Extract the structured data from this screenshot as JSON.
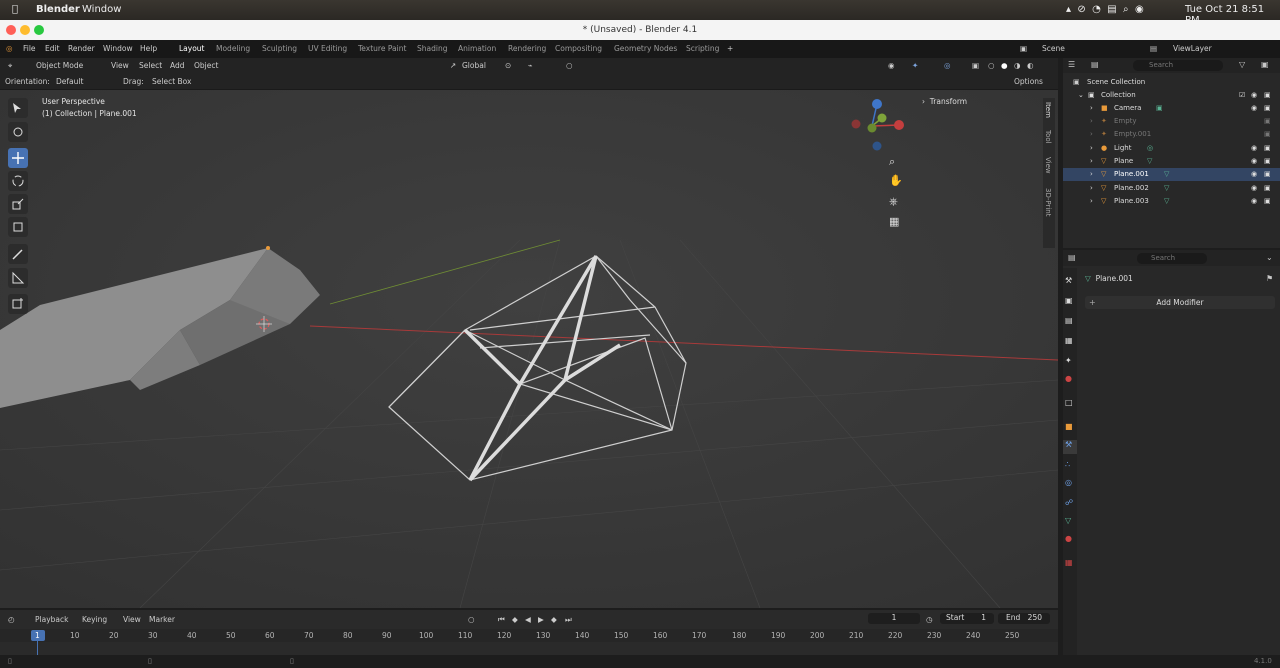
{
  "macbar": {
    "app": "Blender",
    "menu_window": "Window",
    "clock": "Tue Oct 21  8:51 PM"
  },
  "window_title": "* (Unsaved) - Blender 4.1",
  "menu": {
    "file": "File",
    "edit": "Edit",
    "render": "Render",
    "window": "Window",
    "help": "Help"
  },
  "workspaces": [
    "Layout",
    "Modeling",
    "Sculpting",
    "UV Editing",
    "Texture Paint",
    "Shading",
    "Animation",
    "Rendering",
    "Compositing",
    "Geometry Nodes",
    "Scripting"
  ],
  "scene": "Scene",
  "view_layer": "ViewLayer",
  "viewport_header": {
    "mode": "Object Mode",
    "view": "View",
    "select": "Select",
    "add": "Add",
    "object": "Object",
    "transform_space": "Global"
  },
  "tool_header": {
    "orientation_label": "Orientation:",
    "orientation_value": "Default",
    "drag_label": "Drag:",
    "drag_value": "Select Box",
    "options": "Options"
  },
  "overlay": {
    "perspective": "User Perspective",
    "collection": "(1) Collection | Plane.001"
  },
  "n_panel": {
    "transform": "Transform",
    "tabs": [
      "Item",
      "Tool",
      "View",
      "3D-Print"
    ]
  },
  "search_placeholder": "Search",
  "outliner": {
    "root": "Scene Collection",
    "collection": "Collection",
    "items": [
      {
        "name": "Camera",
        "dim": false
      },
      {
        "name": "Empty",
        "dim": true
      },
      {
        "name": "Empty.001",
        "dim": true
      },
      {
        "name": "Light",
        "dim": false
      },
      {
        "name": "Plane",
        "dim": false
      },
      {
        "name": "Plane.001",
        "dim": false
      },
      {
        "name": "Plane.002",
        "dim": false
      },
      {
        "name": "Plane.003",
        "dim": false
      }
    ]
  },
  "properties": {
    "object_name": "Plane.001",
    "add_modifier": "Add Modifier"
  },
  "timeline": {
    "playback": "Playback",
    "keying": "Keying",
    "view": "View",
    "marker": "Marker",
    "current_frame": "1",
    "start_label": "Start",
    "start": "1",
    "end_label": "End",
    "end": "250",
    "ticks": [
      "1",
      "10",
      "20",
      "30",
      "40",
      "50",
      "60",
      "70",
      "80",
      "90",
      "100",
      "110",
      "120",
      "130",
      "140",
      "150",
      "160",
      "170",
      "180",
      "190",
      "200",
      "210",
      "220",
      "230",
      "240",
      "250"
    ]
  },
  "version": "4.1.0",
  "colors": {
    "accent": "#4772b3",
    "axis_x": "#c33e3e",
    "axis_y": "#7fa43a",
    "axis_z": "#3f76c9",
    "selected": "#e99a3a"
  }
}
